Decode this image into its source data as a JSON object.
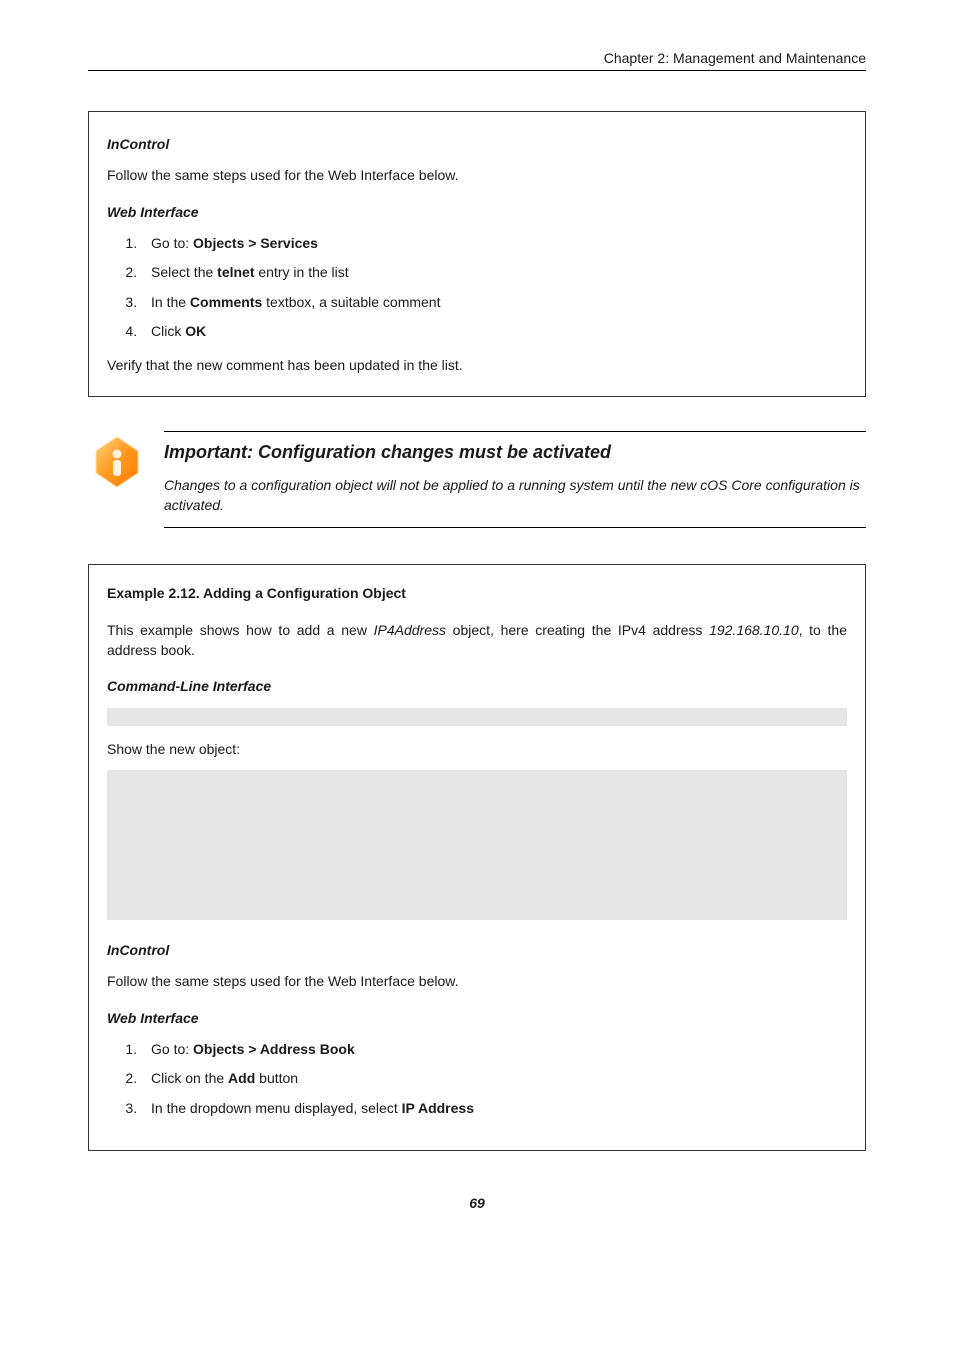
{
  "header": {
    "chapter": "Chapter 2: Management and Maintenance"
  },
  "box1": {
    "incontrol_heading": "InControl",
    "incontrol_text": "Follow the same steps used for the Web Interface below.",
    "web_heading": "Web Interface",
    "steps": {
      "s1_pre": "Go to: ",
      "s1_b": "Objects > Services",
      "s2_pre": "Select the ",
      "s2_b": "telnet",
      "s2_post": " entry in the list",
      "s3_pre": "In the ",
      "s3_b": "Comments",
      "s3_post": " textbox, a suitable comment",
      "s4_pre": "Click ",
      "s4_b": "OK"
    },
    "verify": "Verify that the new comment has been updated in the list."
  },
  "callout": {
    "title": "Important: Configuration changes must be activated",
    "text": "Changes to a configuration object will not be applied to a running system until the new cOS Core configuration is activated."
  },
  "box2": {
    "example_title": "Example 2.12. Adding a Configuration Object",
    "desc_pre": "This example shows how to add a new ",
    "desc_em": "IP4Address",
    "desc_mid": " object, here creating the IPv4 address ",
    "desc_em2": "192.168.10.10",
    "desc_post": ", to the address book.",
    "cli_heading": "Command-Line Interface",
    "show_new": "Show the new object:",
    "incontrol_heading": "InControl",
    "incontrol_text": "Follow the same steps used for the Web Interface below.",
    "web_heading": "Web Interface",
    "steps": {
      "s1_pre": "Go to: ",
      "s1_b": "Objects > Address Book",
      "s2_pre": "Click on the ",
      "s2_b": "Add",
      "s2_post": " button",
      "s3_pre": "In the dropdown menu displayed, select ",
      "s3_b": "IP Address"
    }
  },
  "page_number": "69"
}
